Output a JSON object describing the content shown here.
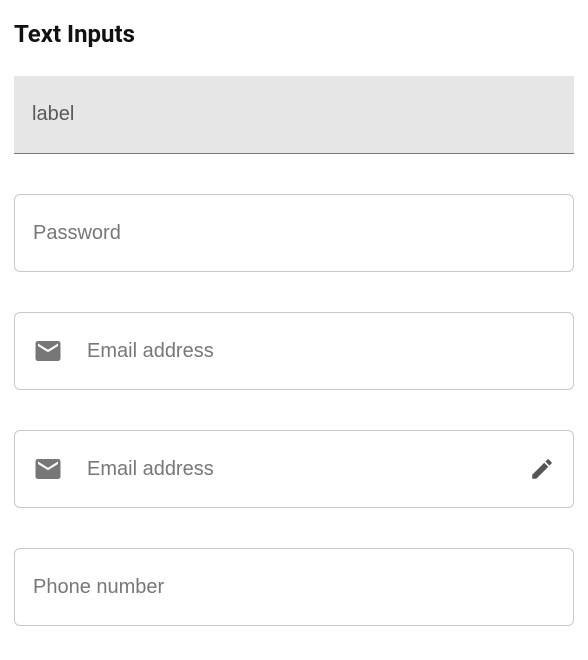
{
  "page": {
    "title": "Text Inputs"
  },
  "fields": {
    "label": {
      "placeholder": "label",
      "value": ""
    },
    "password": {
      "placeholder": "Password",
      "value": ""
    },
    "email1": {
      "placeholder": "Email address",
      "value": "",
      "leading_icon": "email-icon"
    },
    "email2": {
      "placeholder": "Email address",
      "value": "",
      "leading_icon": "email-icon",
      "trailing_icon": "edit-icon"
    },
    "phone": {
      "placeholder": "Phone number",
      "value": ""
    }
  }
}
